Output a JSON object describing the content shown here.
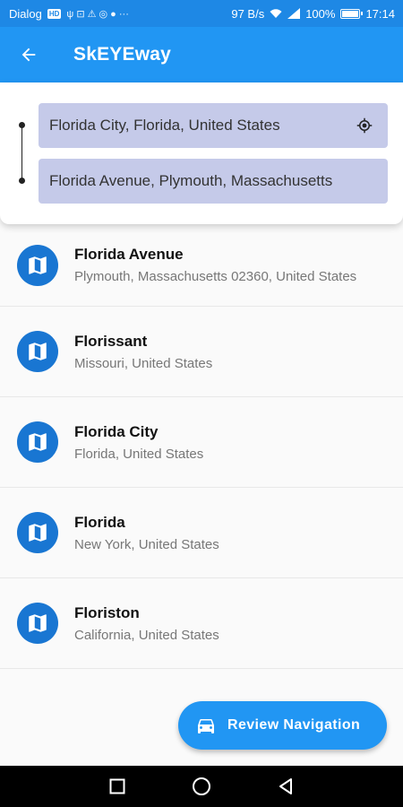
{
  "status_bar": {
    "carrier": "Dialog",
    "carrier_badge": "HD",
    "net_speed": "97 B/s",
    "battery_pct": "100%",
    "time": "17:14",
    "notif_glyphs": "ψ ⊡ ⚠ ◎ ● ···"
  },
  "app_bar": {
    "title": "SkEYEway"
  },
  "search": {
    "origin_value": "Florida City, Florida, United States",
    "destination_value": "Florida Avenue, Plymouth, Massachusetts"
  },
  "results": [
    {
      "title": "Florida Avenue",
      "subtitle": "Plymouth, Massachusetts 02360, United States"
    },
    {
      "title": "Florissant",
      "subtitle": "Missouri, United States"
    },
    {
      "title": "Florida City",
      "subtitle": "Florida, United States"
    },
    {
      "title": "Florida",
      "subtitle": "New York, United States"
    },
    {
      "title": "Floriston",
      "subtitle": "California, United States"
    }
  ],
  "fab": {
    "label": "Review Navigation",
    "icon": "car-icon"
  },
  "colors": {
    "status_bar": "#1e88e5",
    "app_bar": "#2196f3",
    "field_bg": "#c5cae9",
    "map_badge": "#1976d2"
  }
}
